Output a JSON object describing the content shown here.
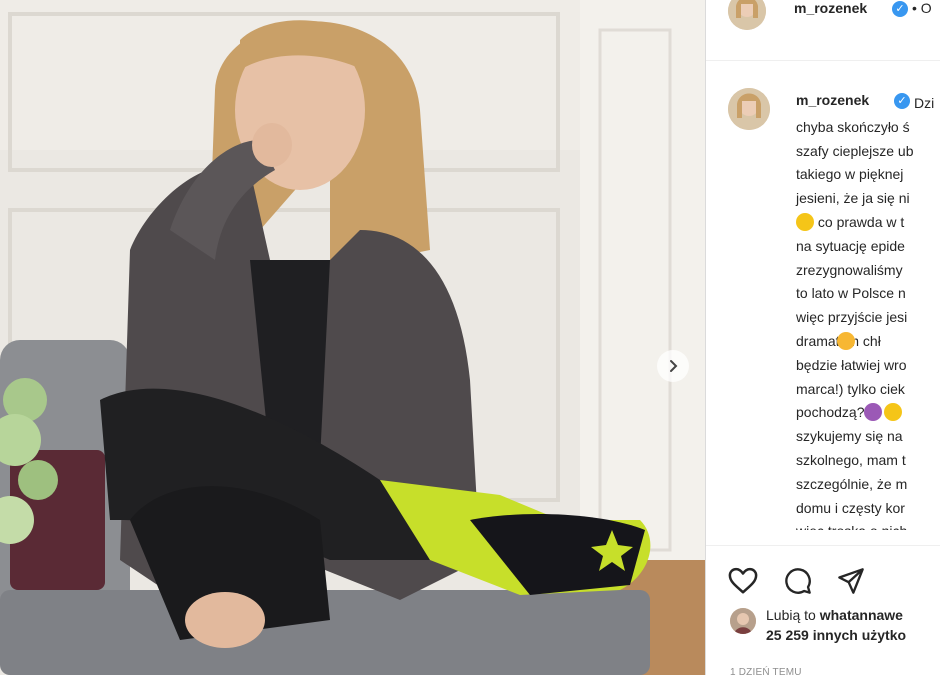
{
  "post": {
    "username": "m_rozenek",
    "header_follow_dot": "• O",
    "caption_lines": [
      "Dzi",
      "chyba skończyło ś",
      "szafy cieplejsze ub",
      "takiego w pięknej",
      "jesieni, że ja się ni",
      " co prawda w t",
      "na sytuację epide",
      "zrezygnowaliśmy",
      "to lato w Polsce n",
      "więc przyjście jesi",
      "dramatem  chł",
      "będzie łatwiej wro",
      "marca!) tylko ciek",
      "pochodzą?  ",
      "szykujemy się na",
      "szkolnego, mam t",
      "szczególnie, że m",
      "domu i częsty kor",
      "więc troska o nich"
    ],
    "likes_prefix": "Lubią to",
    "likes_user": "whatannawe",
    "likes_count": "25 259 innych użytko",
    "timestamp": "1 DZIEŃ TEMU"
  },
  "icons": {
    "next": "chevron-right-icon",
    "like": "heart-icon",
    "comment": "comment-icon",
    "share": "share-icon",
    "verified": "verified-badge-icon"
  },
  "colors": {
    "verified": "#3897f0",
    "text": "#262626",
    "muted": "#8e8e8e",
    "border": "#dbdbdb"
  }
}
